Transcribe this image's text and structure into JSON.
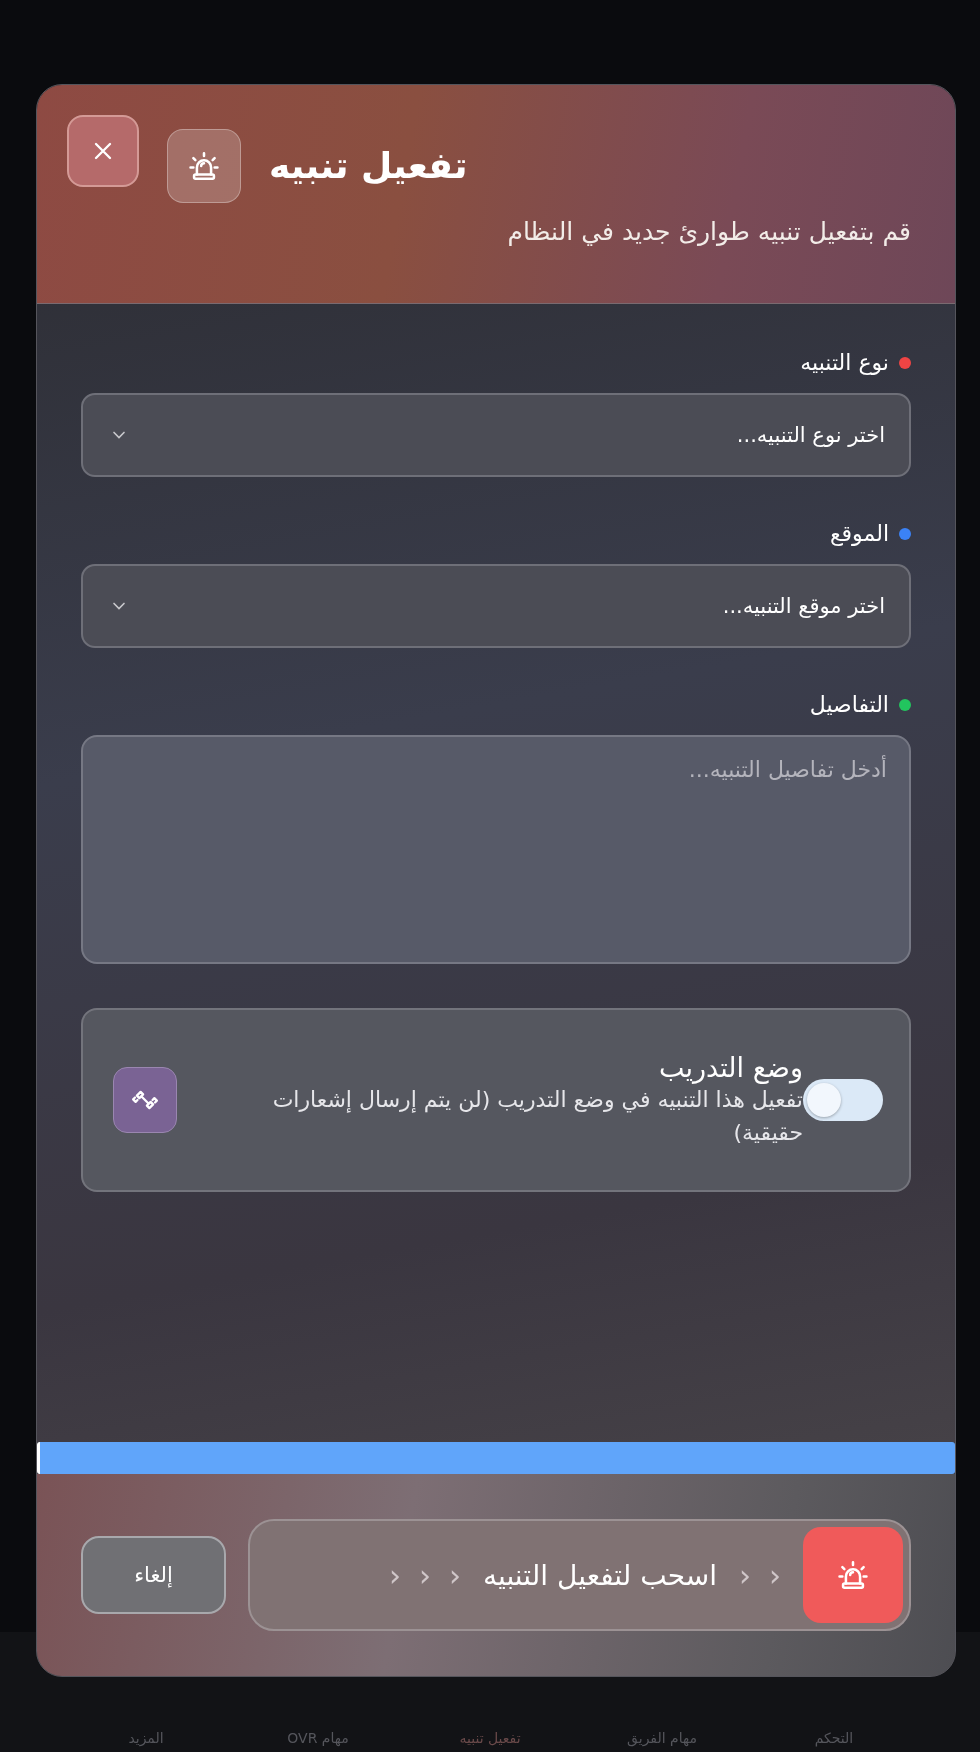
{
  "bottom_nav": [
    {
      "label": "التحكم",
      "selected": false
    },
    {
      "label": "مهام الفريق",
      "selected": false
    },
    {
      "label": "تفعيل تنبيه",
      "selected": true
    },
    {
      "label": "مهام OVR",
      "selected": false
    },
    {
      "label": "المزيد",
      "selected": false
    }
  ],
  "dialog": {
    "title": "تفعيل تنبيه",
    "subtitle": "قم بتفعيل تنبيه طوارئ جديد في النظام",
    "fields": [
      {
        "kind": "select",
        "label": "نوع التنبيه",
        "color": "#ef4444",
        "placeholder": "اختر نوع التنبيه..."
      },
      {
        "kind": "select",
        "label": "الموقع",
        "color": "#3b82f6",
        "placeholder": "اختر موقع التنبيه..."
      },
      {
        "kind": "textarea",
        "label": "التفاصيل",
        "color": "#22c55e",
        "placeholder": "أدخل تفاصيل التنبيه..."
      }
    ],
    "training_mode": {
      "title": "وضع التدريب",
      "description": "تفعيل هذا التنبيه في وضع التدريب (لن يتم إرسال إشعارات حقيقية)",
      "on": false
    },
    "progress": {
      "level": 1
    },
    "slide_to_activate": {
      "label": "اسحب لتفعيل التنبيه",
      "chevrons": [
        "‹",
        "‹",
        "‹",
        "‹",
        "‹"
      ]
    },
    "cancel_button": "إلغاء"
  }
}
